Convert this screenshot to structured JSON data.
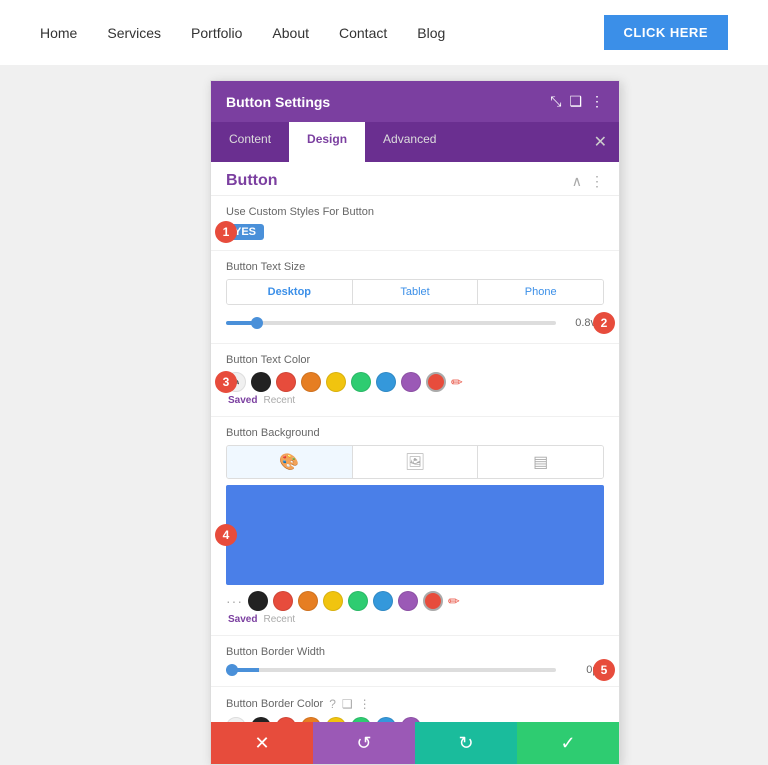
{
  "nav": {
    "links": [
      "Home",
      "Services",
      "Portfolio",
      "About",
      "Contact",
      "Blog"
    ],
    "cta_label": "CLICK HERE"
  },
  "panel": {
    "title": "Button Settings",
    "tabs": [
      "Content",
      "Design",
      "Advanced"
    ],
    "active_tab": "Design",
    "section_title": "Button",
    "settings": {
      "custom_styles_label": "Use Custom Styles For Button",
      "toggle_value": "YES",
      "text_size_label": "Button Text Size",
      "responsive_tabs": [
        "Desktop",
        "Tablet",
        "Phone"
      ],
      "active_responsive_tab": "Desktop",
      "slider_value": "0.8vw",
      "text_color_label": "Button Text Color",
      "bg_label": "Button Background",
      "border_width_label": "Button Border Width",
      "border_width_value": "0px",
      "border_color_label": "Button Border Color",
      "saved_label": "Saved",
      "recent_label": "Recent"
    },
    "color_swatches": [
      "#222222",
      "#e74c3c",
      "#e67e22",
      "#f1c40f",
      "#2ecc71",
      "#3498db",
      "#9b59b6",
      "#e74c3c"
    ],
    "color_preview": "#4a7fe8",
    "step_badges": [
      "1",
      "2",
      "3",
      "4",
      "5"
    ],
    "action_bar": {
      "cancel_icon": "✕",
      "undo_icon": "↺",
      "redo_icon": "↻",
      "save_icon": "✓"
    }
  }
}
